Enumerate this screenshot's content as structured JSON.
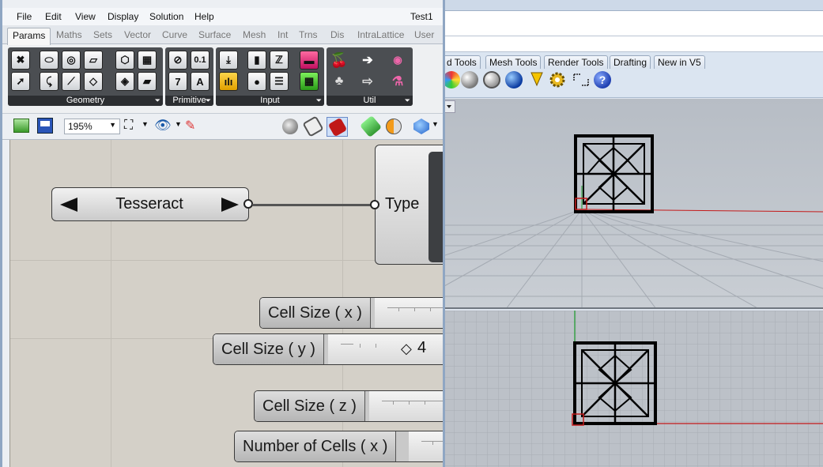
{
  "gh": {
    "title": "Test1",
    "menu": [
      "File",
      "Edit",
      "View",
      "Display",
      "Solution",
      "Help"
    ],
    "tabs": [
      "Params",
      "Maths",
      "Sets",
      "Vector",
      "Curve",
      "Surface",
      "Mesh",
      "Int",
      "Trns",
      "Dis",
      "IntraLattice",
      "User"
    ],
    "active_tab": "Params",
    "panels": {
      "geometry": "Geometry",
      "primitive": "Primitive",
      "input": "Input",
      "util": "Util"
    },
    "zoom": "195%",
    "canvas": {
      "value_list": "Tesseract",
      "type_param": "Type",
      "sliders": [
        {
          "label": "Cell Size ( x )",
          "value": ""
        },
        {
          "label": "Cell Size ( y )",
          "value": "4"
        },
        {
          "label": "Cell Size ( z )",
          "value": ""
        },
        {
          "label": "Number of Cells ( x )",
          "value": ""
        }
      ]
    },
    "primitive_icons": {
      "integer": "0.1",
      "number": "7",
      "text": "A"
    }
  },
  "rhino": {
    "tabs": [
      "d Tools",
      "Mesh Tools",
      "Render Tools",
      "Drafting",
      "New in V5"
    ],
    "icons": [
      "render-sphere-icon",
      "shaded-sphere-icon",
      "ghosted-sphere-icon",
      "blue-sphere-icon",
      "light-icon",
      "gear-icon",
      "dimension-icon",
      "help-icon"
    ]
  },
  "colors": {
    "gh_panel": "#4b4e52",
    "gh_canvas": "#d4d0c8",
    "rhino_toolbar": "#dbe5f1",
    "axis_red": "#c41a1a",
    "axis_green": "#1a9a2a"
  }
}
